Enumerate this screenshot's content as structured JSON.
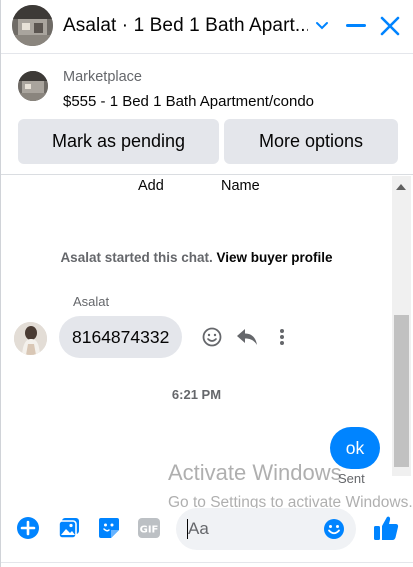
{
  "header": {
    "title": "Asalat · 1 Bed 1 Bath Apart...",
    "icons": [
      "chevron-down-icon",
      "minimize-icon",
      "close-icon"
    ],
    "accent": "#0084ff"
  },
  "marketplace": {
    "label": "Marketplace",
    "listing": "$555 - 1 Bed 1 Bath Apartment/condo",
    "pending_button": "Mark as pending",
    "more_button": "More options"
  },
  "messages": {
    "top_fragment_left": "Add",
    "top_fragment_right": "Name",
    "system_text": "Asalat started this chat.",
    "system_link": "View buyer profile",
    "sender_name": "Asalat",
    "incoming_text": "8164874332",
    "timestamp": "6:21 PM",
    "outgoing_text": "ok",
    "outgoing_status": "Sent"
  },
  "watermark": {
    "line1": "Activate Windows",
    "line2": "Go to Settings to activate Windows."
  },
  "composer": {
    "placeholder": "Aa",
    "icons": [
      "plus-icon",
      "photo-icon",
      "sticker-icon",
      "gif-icon",
      "emoji-icon",
      "like-icon"
    ]
  }
}
